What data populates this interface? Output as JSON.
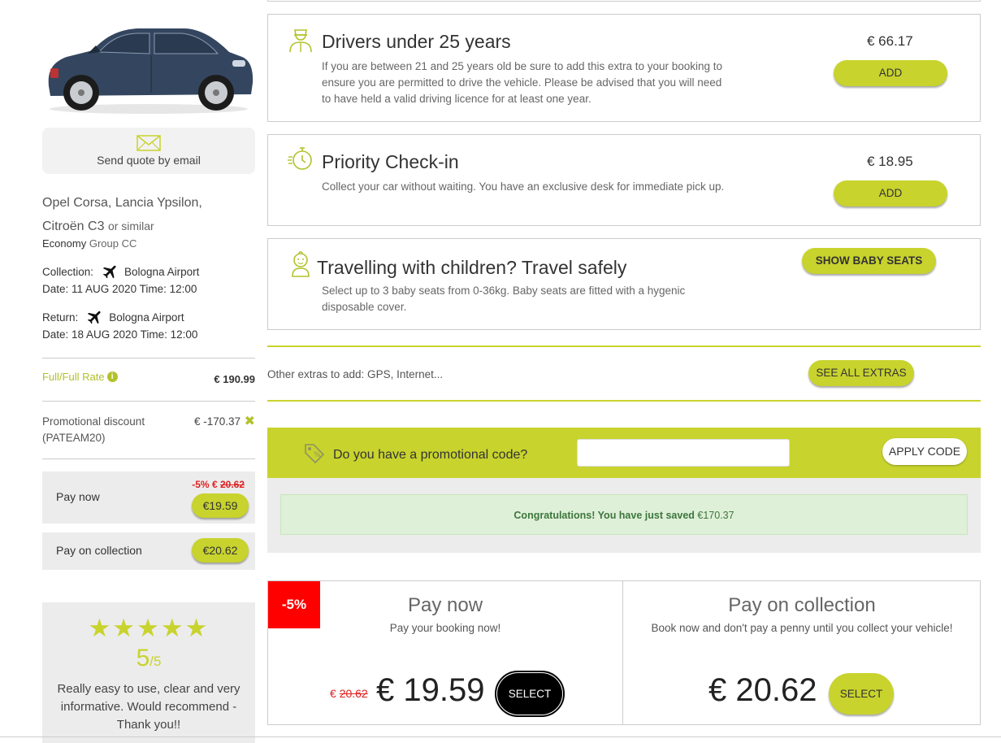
{
  "sidebar": {
    "send_quote": "Send quote by email",
    "car_name_line1": "Opel Corsa, Lancia Ypsilon,",
    "car_name_line2": "Citroën C3",
    "or_similar": "or similar",
    "group_name": "Economy",
    "group_suffix": "Group CC",
    "collection_label": "Collection:",
    "collection_location": "Bologna Airport",
    "collection_datetime": "Date: 11 AUG 2020 Time: 12:00",
    "return_label": "Return:",
    "return_location": "Bologna Airport",
    "return_datetime": "Date: 18 AUG 2020 Time: 12:00",
    "rate_label": "Full/Full Rate",
    "rate_info": "i",
    "rate_value": "€ 190.99",
    "promo_label_line1": "Promotional discount",
    "promo_label_line2": "(PATEAM20)",
    "promo_value": "€ -170.37",
    "promo_remove": "✖",
    "pay_now_label": "Pay now",
    "pay_now_discount": "-5% €",
    "pay_now_old": "20.62",
    "pay_now_price": "€19.59",
    "pay_collection_label": "Pay on collection",
    "pay_collection_price": "€20.62"
  },
  "review": {
    "stars": "★★★★★",
    "score": "5",
    "score_max": "/5",
    "text": "Really easy to use, clear and very informative. Would recommend - Thank you!!"
  },
  "extras": [
    {
      "title": "Drivers under 25 years",
      "description": "If you are between 21 and 25 years old be sure to add this extra to your booking to ensure you are permitted to drive the vehicle. Please be advised that you will need to have held a valid driving licence for at least one year.",
      "price": "€ 66.17",
      "button": "ADD"
    },
    {
      "title": "Priority Check-in",
      "description": "Collect your car without waiting. You have an exclusive desk for immediate pick up.",
      "price": "€ 18.95",
      "button": "ADD"
    },
    {
      "title": "Travelling with children? Travel safely",
      "description": "Select up to 3 baby seats from 0-36kg. Baby seats are fitted with a hygenic disposable cover.",
      "button": "SHOW BABY SEATS"
    }
  ],
  "other_extras": {
    "text": "Other extras to add: GPS, Internet...",
    "button": "SEE ALL EXTRAS"
  },
  "promo": {
    "label": "Do you have a promotional code?",
    "input_value": "",
    "button": "APPLY CODE",
    "congrats_bold": "Congratulations! You have just saved",
    "congrats_amount": "€170.37"
  },
  "pay_options": {
    "badge": "-5%",
    "now_title": "Pay now",
    "now_subtitle": "Pay your booking now!",
    "now_old_currency": "€",
    "now_old_price": "20.62",
    "now_price": "€ 19.59",
    "now_button": "SELECT",
    "collection_title": "Pay on collection",
    "collection_subtitle": "Book now and don't pay a penny until you collect your vehicle!",
    "collection_price": "€ 20.62",
    "collection_button": "SELECT"
  },
  "colors": {
    "accent": "#c8d32d",
    "accent_text": "#b2c22a",
    "discount_red": "#ff0000",
    "success_bg": "#dff0d8",
    "success_text": "#3c763d"
  }
}
